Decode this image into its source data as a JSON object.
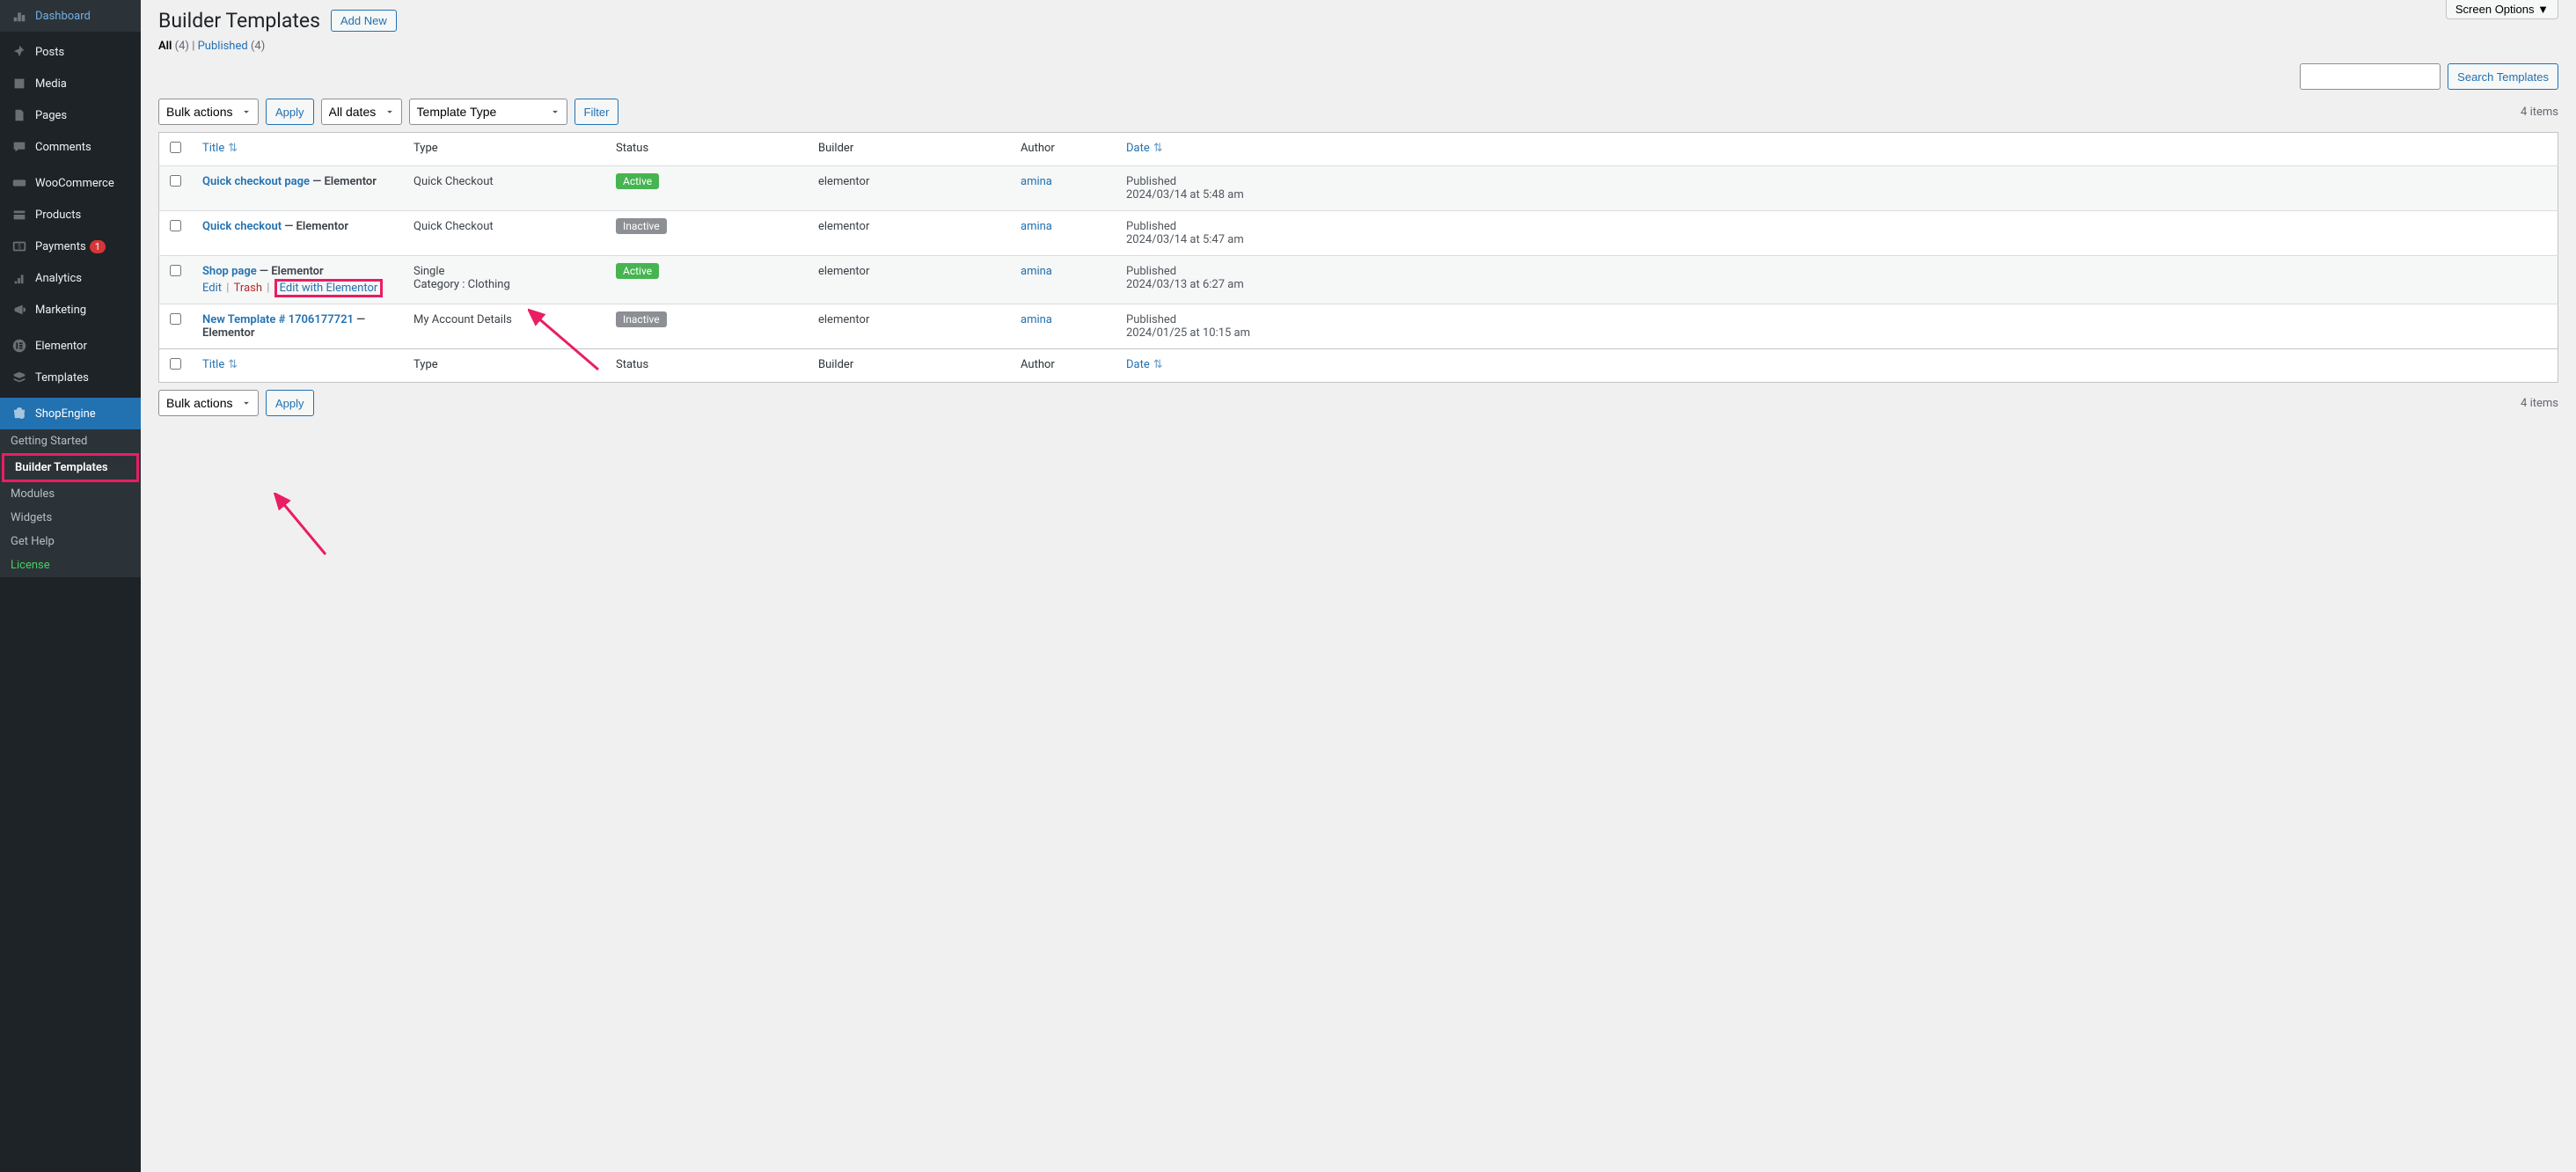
{
  "sidebar": {
    "items": [
      {
        "label": "Dashboard",
        "icon": "dashboard"
      },
      {
        "label": "Posts",
        "icon": "pin"
      },
      {
        "label": "Media",
        "icon": "media"
      },
      {
        "label": "Pages",
        "icon": "page"
      },
      {
        "label": "Comments",
        "icon": "comment"
      },
      {
        "label": "WooCommerce",
        "icon": "woo"
      },
      {
        "label": "Products",
        "icon": "products"
      },
      {
        "label": "Payments",
        "icon": "payments",
        "badge": "1"
      },
      {
        "label": "Analytics",
        "icon": "analytics"
      },
      {
        "label": "Marketing",
        "icon": "marketing"
      },
      {
        "label": "Elementor",
        "icon": "elementor"
      },
      {
        "label": "Templates",
        "icon": "templates"
      },
      {
        "label": "ShopEngine",
        "icon": "shopengine",
        "active": true
      }
    ],
    "submenu": [
      {
        "label": "Getting Started"
      },
      {
        "label": "Builder Templates",
        "current": true,
        "highlight": true
      },
      {
        "label": "Modules"
      },
      {
        "label": "Widgets"
      },
      {
        "label": "Get Help"
      },
      {
        "label": "License",
        "license": true
      }
    ]
  },
  "screen_options_label": "Screen Options",
  "page_title": "Builder Templates",
  "add_new_label": "Add New",
  "filter_links": {
    "all_label": "All",
    "all_count": "(4)",
    "published_label": "Published",
    "published_count": "(4)",
    "sep": " | "
  },
  "search_button_label": "Search Templates",
  "bulk_actions_label": "Bulk actions",
  "apply_label": "Apply",
  "all_dates_label": "All dates",
  "template_type_label": "Template Type",
  "filter_label": "Filter",
  "items_count_label": "4 items",
  "columns": {
    "title": "Title",
    "type": "Type",
    "status": "Status",
    "builder": "Builder",
    "author": "Author",
    "date": "Date"
  },
  "rows": [
    {
      "title": "Quick checkout page",
      "suffix": " — Elementor",
      "type_line1": "Quick Checkout",
      "type_line2": "",
      "status": "Active",
      "status_kind": "active",
      "builder": "elementor",
      "author": "amina",
      "date_pub": "Published",
      "date_val": "2024/03/14 at 5:48 am",
      "show_actions": false
    },
    {
      "title": "Quick checkout",
      "suffix": " — Elementor",
      "type_line1": "Quick Checkout",
      "type_line2": "",
      "status": "Inactive",
      "status_kind": "inactive",
      "builder": "elementor",
      "author": "amina",
      "date_pub": "Published",
      "date_val": "2024/03/14 at 5:47 am",
      "show_actions": false
    },
    {
      "title": "Shop page",
      "suffix": " — Elementor",
      "type_line1": "Single",
      "type_line2": "Category : Clothing",
      "status": "Active",
      "status_kind": "active",
      "builder": "elementor",
      "author": "amina",
      "date_pub": "Published",
      "date_val": "2024/03/13 at 6:27 am",
      "show_actions": true,
      "actions": {
        "edit": "Edit",
        "trash": "Trash",
        "ewe": "Edit with Elementor"
      }
    },
    {
      "title": "New Template # 1706177721",
      "suffix": " — Elementor",
      "type_line1": "My Account Details",
      "type_line2": "",
      "status": "Inactive",
      "status_kind": "inactive",
      "builder": "elementor",
      "author": "amina",
      "date_pub": "Published",
      "date_val": "2024/01/25 at 10:15 am",
      "show_actions": false
    }
  ]
}
